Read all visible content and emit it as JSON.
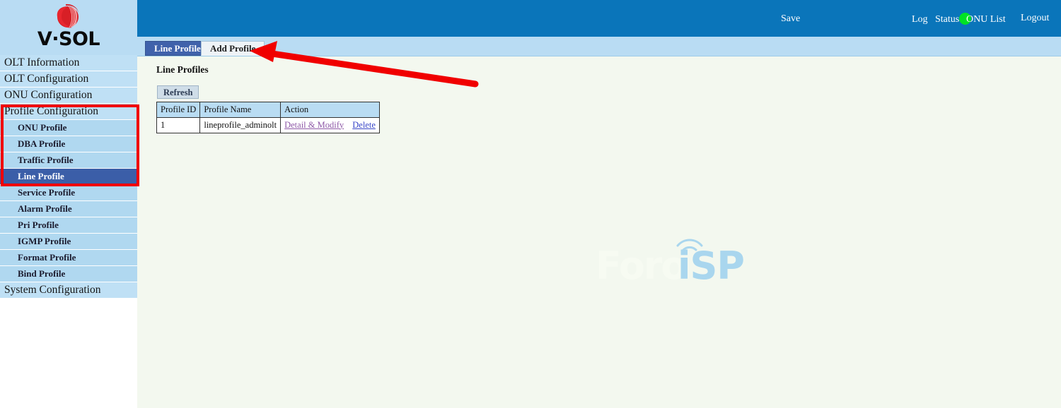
{
  "brand": {
    "logo_text": "V·SOL",
    "logo_icon": "vsol-sphere-logo"
  },
  "topbar": {
    "save_label": "Save",
    "status_indicator": "green-status-dot",
    "status_color": "#00e324",
    "log_label": "Log",
    "status_label": "Status",
    "onu_list_label": "ONU List",
    "logout_label": "Logout",
    "background_color": "#0a75ba"
  },
  "sidebar": {
    "items": [
      {
        "label": "OLT Information",
        "level": "top",
        "active": false
      },
      {
        "label": "OLT Configuration",
        "level": "top",
        "active": false
      },
      {
        "label": "ONU Configuration",
        "level": "top",
        "active": false
      },
      {
        "label": "Profile Configuration",
        "level": "top",
        "active": false
      },
      {
        "label": "ONU Profile",
        "level": "sub",
        "active": false
      },
      {
        "label": "DBA Profile",
        "level": "sub",
        "active": false
      },
      {
        "label": "Traffic Profile",
        "level": "sub",
        "active": false
      },
      {
        "label": "Line Profile",
        "level": "sub",
        "active": true
      },
      {
        "label": "Service Profile",
        "level": "sub",
        "active": false
      },
      {
        "label": "Alarm Profile",
        "level": "sub",
        "active": false
      },
      {
        "label": "Pri Profile",
        "level": "sub",
        "active": false
      },
      {
        "label": "IGMP Profile",
        "level": "sub",
        "active": false
      },
      {
        "label": "Format Profile",
        "level": "sub",
        "active": false
      },
      {
        "label": "Bind Profile",
        "level": "sub",
        "active": false
      },
      {
        "label": "System Configuration",
        "level": "top",
        "active": false
      }
    ]
  },
  "tabs": [
    {
      "label": "Line Profile",
      "active": true
    },
    {
      "label": "Add Profile",
      "active": false
    }
  ],
  "main": {
    "page_title": "Line Profiles",
    "refresh_label": "Refresh",
    "table": {
      "headers": [
        "Profile ID",
        "Profile Name",
        "Action"
      ],
      "rows": [
        {
          "profile_id": "1",
          "profile_name": "lineprofile_adminolt",
          "actions": [
            {
              "label": "Detail & Modify",
              "state": "visited"
            },
            {
              "label": "Delete",
              "state": "unvisited"
            }
          ]
        }
      ]
    }
  },
  "watermark": {
    "part1": "Foro",
    "part2": "iSP",
    "icon": "wifi-signal-arc"
  },
  "annotations": {
    "highlight_color": "#f00000",
    "box_target": "Profile Configuration group",
    "arrow_target": "Add Profile tab"
  }
}
